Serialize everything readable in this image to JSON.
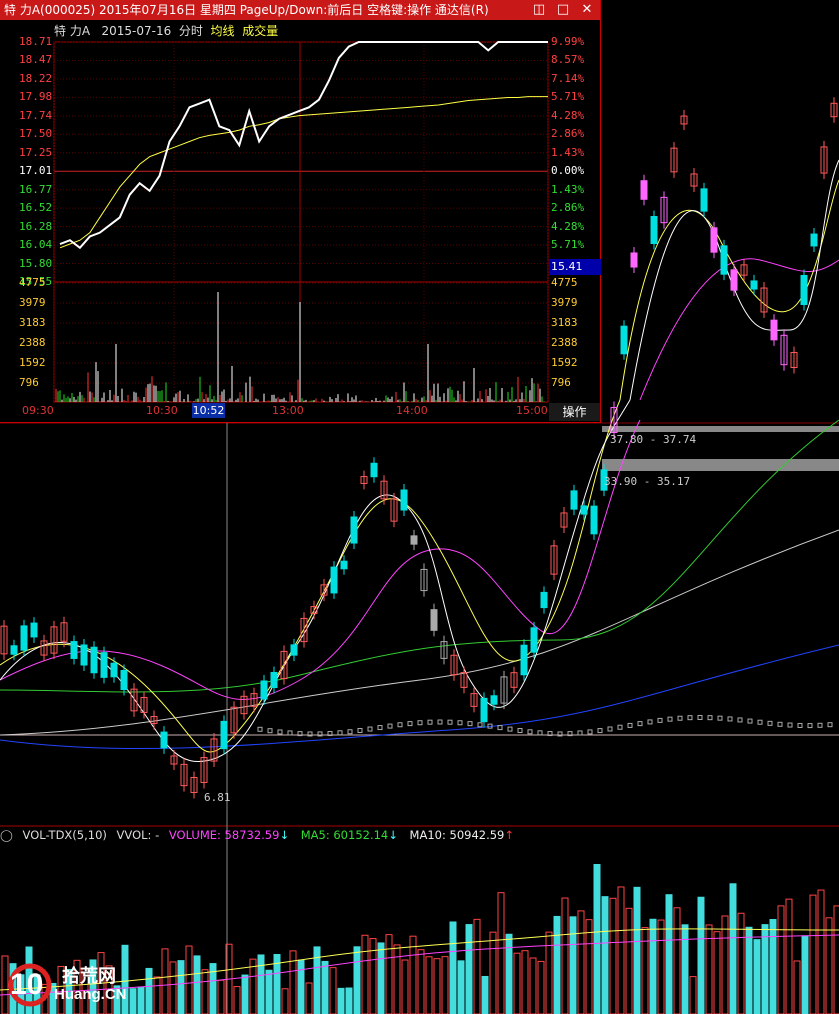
{
  "window": {
    "title": "特 力A(000025) 2015年07月16日 星期四 PageUp/Down:前后日 空格键:操作 通达信(R)",
    "buttons": [
      "◫",
      "□",
      "✕"
    ]
  },
  "intraday": {
    "stock_name": "特 力A",
    "date": "2015-07-16",
    "mode": "分时",
    "legend_avg": "均线",
    "legend_vol": "成交量",
    "price_labels_left": [
      "18.71",
      "18.47",
      "18.22",
      "17.98",
      "17.74",
      "17.50",
      "17.25",
      "17.01",
      "16.77",
      "16.52",
      "16.28",
      "16.04",
      "15.80",
      "15.55"
    ],
    "pct_labels_right": [
      "9.99%",
      "8.57%",
      "7.14%",
      "5.71%",
      "4.28%",
      "2.86%",
      "1.43%",
      "0.00%",
      "1.43%",
      "2.86%",
      "4.28%",
      "5.71%",
      "7.14%"
    ],
    "vol_labels": [
      "4775",
      "3979",
      "3183",
      "2388",
      "1592",
      "796"
    ],
    "current_price": "15.41",
    "time_labels": [
      "09:30",
      "10:30",
      "13:00",
      "14:00",
      "15:00"
    ],
    "cursor_time": "10:52",
    "op_button": "操作",
    "price_series": [
      16.05,
      16.1,
      16.0,
      16.15,
      16.2,
      16.3,
      16.4,
      16.7,
      16.85,
      16.75,
      16.95,
      17.4,
      17.6,
      17.85,
      17.9,
      17.95,
      17.6,
      17.55,
      17.35,
      17.8,
      17.4,
      17.6,
      17.7,
      17.75,
      17.8,
      17.85,
      17.95,
      18.2,
      18.5,
      18.65,
      18.71,
      18.71,
      18.71,
      18.71,
      18.71,
      18.71,
      18.71,
      18.71,
      18.71,
      18.71,
      18.71,
      18.71,
      18.71,
      18.6,
      18.71,
      18.71,
      18.71,
      18.71,
      18.71,
      18.71
    ],
    "avg_series": [
      16.0,
      16.05,
      16.1,
      16.2,
      16.4,
      16.6,
      16.8,
      16.95,
      17.1,
      17.2,
      17.25,
      17.3,
      17.35,
      17.4,
      17.45,
      17.48,
      17.5,
      17.52,
      17.55,
      17.6,
      17.62,
      17.65,
      17.7,
      17.72,
      17.74,
      17.75,
      17.76,
      17.77,
      17.78,
      17.79,
      17.8,
      17.81,
      17.82,
      17.83,
      17.84,
      17.85,
      17.86,
      17.87,
      17.88,
      17.9,
      17.92,
      17.94,
      17.95,
      17.96,
      17.97,
      17.98,
      17.98,
      17.99,
      17.99,
      17.99
    ]
  },
  "kline": {
    "annotation_low": "6.81",
    "annotation_range1": "37.80 - 37.74",
    "annotation_range2": "33.90 - 35.17"
  },
  "volume_panel": {
    "indicator": "VOL-TDX(5,10)",
    "vvol": "VVOL: -",
    "volume_label": "VOLUME: 58732.59",
    "ma5_label": "MA5: 60152.14",
    "ma10_label": "MA10: 50942.59"
  },
  "watermark": {
    "number": "10",
    "cn": "拾荒网",
    "en": "Huang.CN"
  },
  "colors": {
    "up": "#ff3b3b",
    "down": "#00d0d0",
    "flat": "#aaaaaa",
    "ma5": "#ffffff",
    "ma10": "#ffff55",
    "ma20": "#ff44ff",
    "ma60": "#33cc33",
    "ma120": "#cccccc",
    "ma250": "#2244ff"
  }
}
